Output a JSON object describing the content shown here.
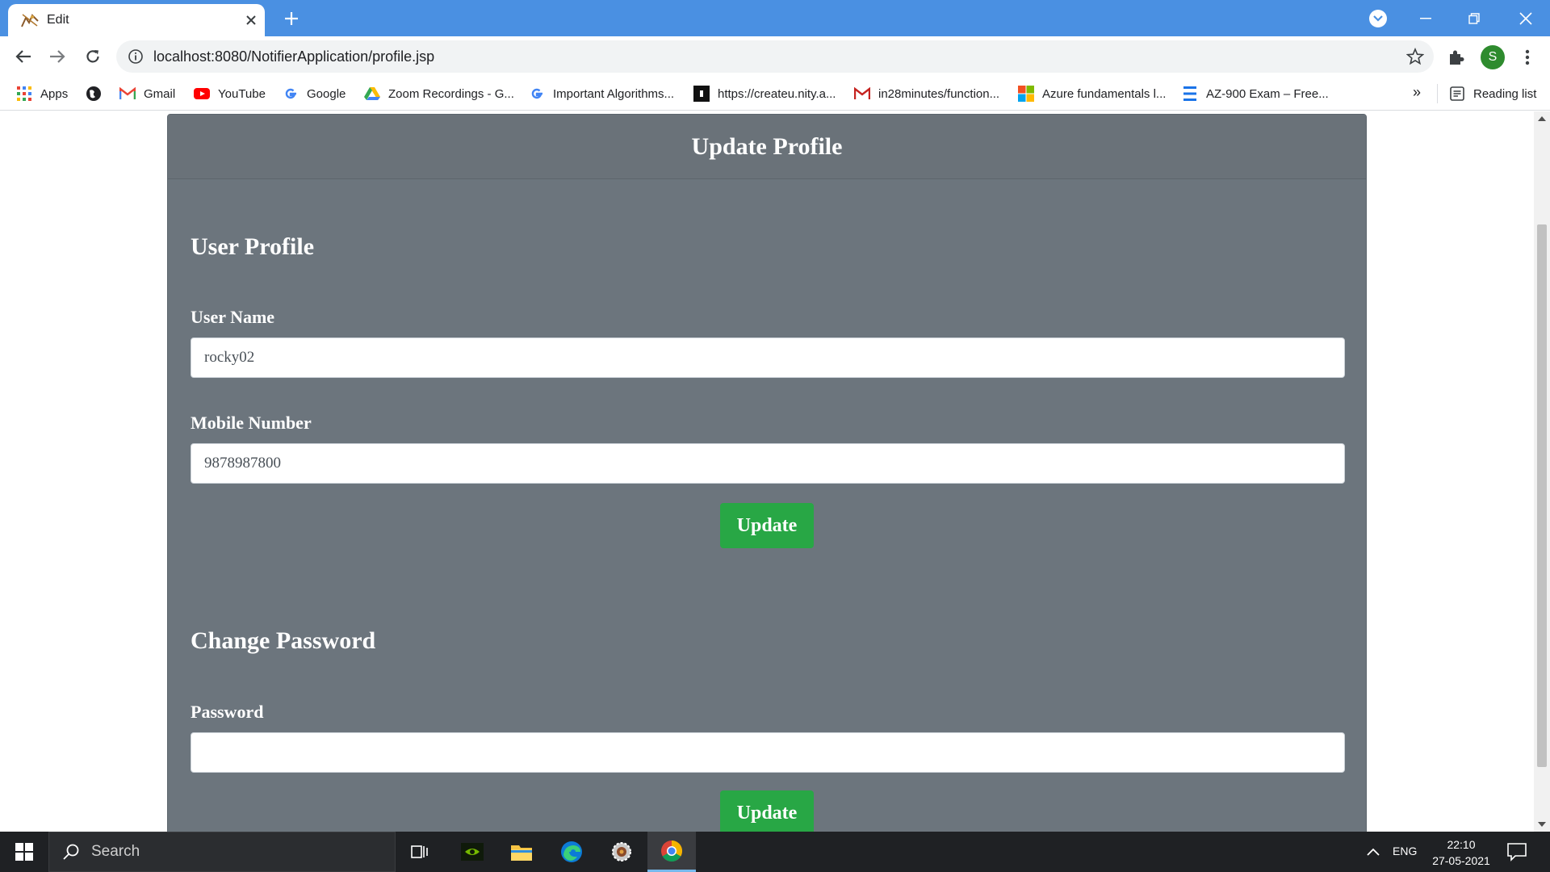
{
  "browser": {
    "tab_title": "Edit",
    "url": "localhost:8080/NotifierApplication/profile.jsp",
    "profile_initial": "S",
    "bookmarks": [
      {
        "label": "Apps",
        "icon": "apps-grid-icon"
      },
      {
        "label": "",
        "icon": "globe-icon"
      },
      {
        "label": "Gmail",
        "icon": "gmail-icon"
      },
      {
        "label": "YouTube",
        "icon": "youtube-icon"
      },
      {
        "label": "Google",
        "icon": "google-icon"
      },
      {
        "label": "Zoom Recordings - G...",
        "icon": "google-drive-icon"
      },
      {
        "label": "Important Algorithms...",
        "icon": "google-icon"
      },
      {
        "label": "https://createu.nity.a...",
        "icon": "black-square-icon"
      },
      {
        "label": "in28minutes/function...",
        "icon": "gmail-icon"
      },
      {
        "label": "Azure fundamentals l...",
        "icon": "microsoft-icon"
      },
      {
        "label": "AZ-900 Exam – Free...",
        "icon": "doc-lines-icon"
      }
    ],
    "more_label": "»",
    "reading_list": "Reading list"
  },
  "page": {
    "header_title": "Update Profile",
    "profile_section_title": "User Profile",
    "username_label": "User Name",
    "username_value": "rocky02",
    "mobile_label": "Mobile Number",
    "mobile_value": "9878987800",
    "update_label": "Update",
    "password_section_title": "Change Password",
    "password_label": "Password",
    "password_value": "",
    "update_password_label": "Update"
  },
  "taskbar": {
    "search_placeholder": "Search",
    "language": "ENG",
    "time": "22:10",
    "date": "27-05-2021"
  },
  "colors": {
    "tabbar": "#4a90e2",
    "card": "#6c757d",
    "update_button": "#28a745"
  }
}
